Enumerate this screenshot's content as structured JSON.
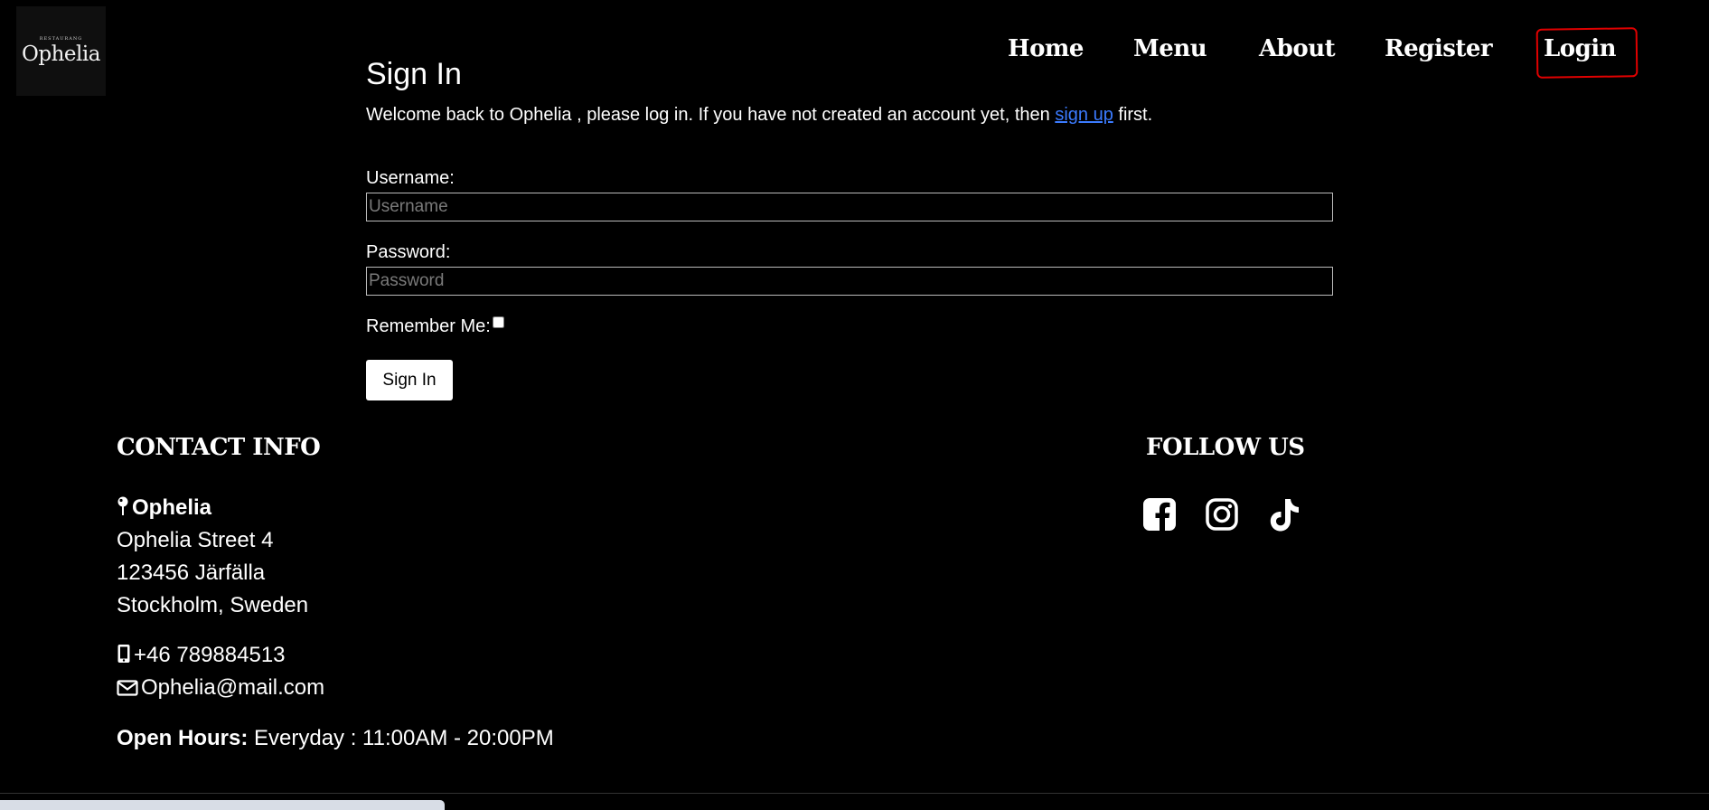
{
  "logo": {
    "small_text": "RESTAURANG",
    "name": "Ophelia"
  },
  "nav": {
    "items": [
      {
        "label": "Home"
      },
      {
        "label": "Menu"
      },
      {
        "label": "About"
      },
      {
        "label": "Register"
      },
      {
        "label": "Login"
      }
    ],
    "active": "Login",
    "highlight_color": "#e00000"
  },
  "signin": {
    "title": "Sign In",
    "welcome_before": "Welcome back to Ophelia , please log in. If you have not created an account yet, then ",
    "signup_link": "sign up",
    "welcome_after": " first.",
    "username_label": "Username:",
    "username_placeholder": "Username",
    "username_value": "",
    "password_label": "Password:",
    "password_placeholder": "Password",
    "password_value": "",
    "remember_label": "Remember Me:",
    "remember_checked": false,
    "button_label": "Sign In"
  },
  "footer": {
    "contact_heading": "CONTACT INFO",
    "name": "Ophelia",
    "street": "Ophelia Street 4",
    "postal": "123456 Järfälla",
    "city": "Stockholm, Sweden",
    "phone": "+46 789884513",
    "email": "Ophelia@mail.com",
    "hours_label": "Open Hours:",
    "hours_value": " Everyday : 11:00AM - 20:00PM",
    "follow_heading": "FOLLOW US",
    "socials": [
      "facebook-icon",
      "instagram-icon",
      "tiktok-icon"
    ]
  },
  "colors": {
    "background": "#000000",
    "link": "#3b7bff",
    "text": "#ffffff"
  }
}
